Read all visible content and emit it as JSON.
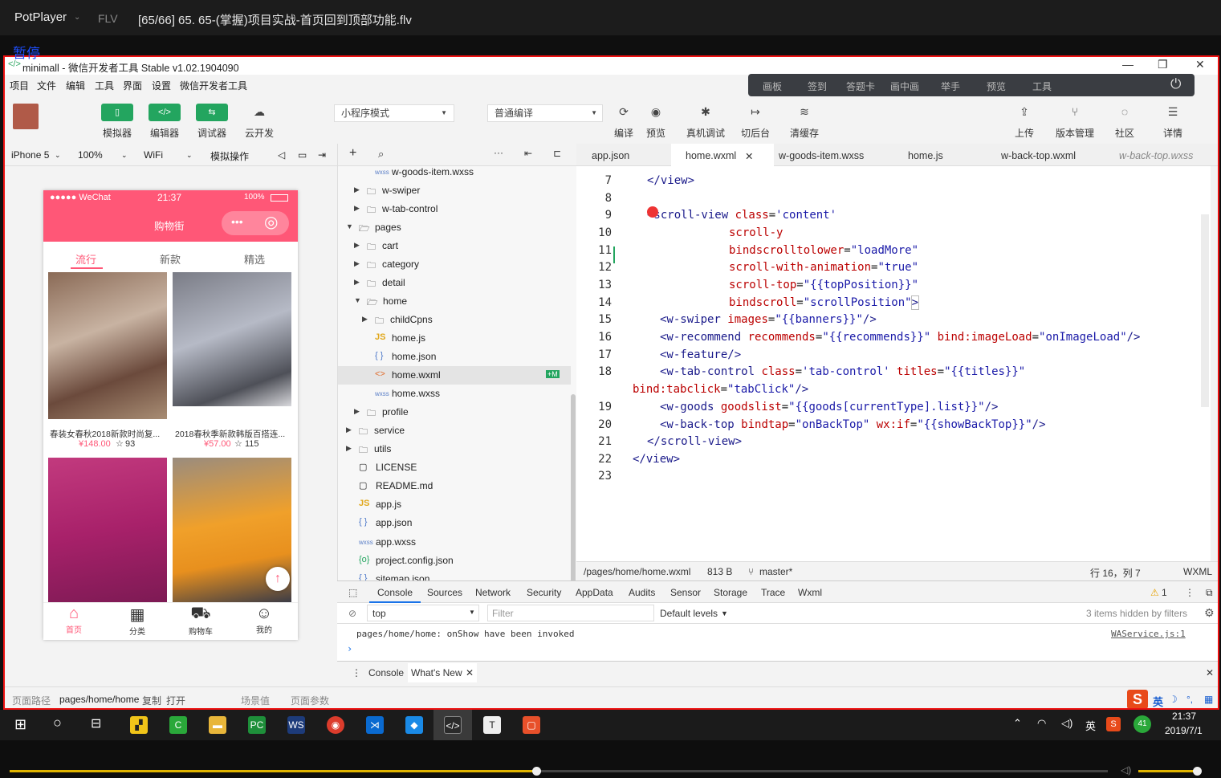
{
  "player": {
    "brand": "PotPlayer",
    "format": "FLV",
    "title": "[65/66] 65. 65-(掌握)项目实战-首页回到顶部功能.flv",
    "pause_text": "暂停"
  },
  "window": {
    "title": "minimall - 微信开发者工具 Stable v1.02.1904090"
  },
  "menu": [
    "项目",
    "文件",
    "编辑",
    "工具",
    "界面",
    "设置",
    "微信开发者工具"
  ],
  "overlay_menu": [
    "画板",
    "签到",
    "答题卡",
    "画中画",
    "举手",
    "预览",
    "工具"
  ],
  "toolbar": {
    "simulator": "模拟器",
    "editor": "编辑器",
    "debugger": "调试器",
    "cloud": "云开发",
    "mode": "小程序模式",
    "compile_mode": "普通编译",
    "compile": "编译",
    "preview": "预览",
    "remote_debug": "真机调试",
    "background": "切后台",
    "clear_cache": "清缓存",
    "upload": "上传",
    "version": "版本管理",
    "community": "社区",
    "details": "详情"
  },
  "device_bar": {
    "device": "iPhone 5",
    "zoom": "100%",
    "network": "WiFi",
    "operation": "模拟操作"
  },
  "phone": {
    "carrier": "●●●●● WeChat",
    "time": "21:37",
    "battery": "100%",
    "nav_title": "购物街",
    "tabs": [
      "流行",
      "新款",
      "精选"
    ],
    "goods": [
      {
        "name": "春装女春秋2018新款时尚复...",
        "price": "¥148.00",
        "fav": "93"
      },
      {
        "name": "2018春秋季新款韩版百搭连...",
        "price": "¥57.00",
        "fav": "115"
      }
    ],
    "tabbar": [
      "首页",
      "分类",
      "购物车",
      "我的"
    ]
  },
  "tree": {
    "rows": [
      "w-goods-item.wxss",
      "w-swiper",
      "w-tab-control",
      "pages",
      "cart",
      "category",
      "detail",
      "home",
      "childCpns",
      "home.js",
      "home.json",
      "home.wxml",
      "home.wxss",
      "profile",
      "service",
      "utils",
      "LICENSE",
      "README.md",
      "app.js",
      "app.json",
      "app.wxss",
      "project.config.json",
      "sitemap.json"
    ],
    "badge": "+M"
  },
  "editor_tabs": [
    "app.json",
    "home.wxml",
    "w-goods-item.wxss",
    "home.js",
    "w-back-top.wxml",
    "w-back-top.wxss"
  ],
  "code": {
    "line_numbers": [
      "7",
      "8",
      "9",
      "10",
      "11",
      "12",
      "13",
      "14",
      "15",
      "16",
      "17",
      "18",
      "",
      "19",
      "20",
      "21",
      "22",
      "23"
    ],
    "l7": "</view>",
    "l9a": "<scroll-view ",
    "l9b": "class",
    "l9c": "=",
    "l9d": "'content'",
    "l10": "scroll-y",
    "l11a": "bindscrolltolower",
    "l11b": "=",
    "l11c": "\"loadMore\"",
    "l12a": "scroll-with-animation",
    "l12b": "=",
    "l12c": "\"true\"",
    "l13a": "scroll-top",
    "l13b": "=",
    "l13c": "\"{{topPosition}}\"",
    "l14a": "bindscroll",
    "l14b": "=",
    "l14c": "\"scrollPosition\"",
    "l14d": ">",
    "l15a": "<w-swiper ",
    "l15b": "images",
    "l15c": "=",
    "l15d": "\"{{banners}}\"",
    "l15e": "/>",
    "l16a": "<w-recommend ",
    "l16b": "recommends",
    "l16c": "=",
    "l16d": "\"{{recommends}}\"",
    "l16e": " bind:imageLoad",
    "l16f": "=",
    "l16g": "\"onImageLoad\"",
    "l16h": "/>",
    "l17": "<w-feature/>",
    "l18a": "<w-tab-control ",
    "l18b": "class",
    "l18c": "=",
    "l18d": "'tab-control'",
    "l18e": " titles",
    "l18f": "=",
    "l18g": "\"{{titles}}\"",
    "l18w_a": "bind:tabclick",
    "l18w_b": "=",
    "l18w_c": "\"tabClick\"",
    "l18w_d": "/>",
    "l19a": "<w-goods ",
    "l19b": "goodslist",
    "l19c": "=",
    "l19d": "\"{{goods[currentType].list}}\"",
    "l19e": "/>",
    "l20a": "<w-back-top ",
    "l20b": "bindtap",
    "l20c": "=",
    "l20d": "\"onBackTop\"",
    "l20e": " wx:if",
    "l20f": "=",
    "l20g": "\"{{showBackTop}}\"",
    "l20h": "/>",
    "l21": "</scroll-view>",
    "l22": "</view>"
  },
  "editor_status": {
    "path": "/pages/home/home.wxml",
    "size": "813 B",
    "branch": "master*",
    "position": "行 16，列 7",
    "lang": "WXML"
  },
  "devtools": {
    "tabs": [
      "Console",
      "Sources",
      "Network",
      "Security",
      "AppData",
      "Audits",
      "Sensor",
      "Storage",
      "Trace",
      "Wxml"
    ],
    "warn": "1",
    "context": "top",
    "filter": "Filter",
    "levels": "Default levels",
    "hidden": "3 items hidden by filters",
    "log": "pages/home/home: onShow have been invoked",
    "log_src": "WAService.js:1",
    "drawer": [
      "Console",
      "What's New"
    ]
  },
  "page_status": {
    "path_label": "页面路径",
    "path": "pages/home/home",
    "copy": "复制",
    "open": "打开",
    "scene": "场景值",
    "params": "页面参数"
  },
  "taskbar": {
    "time": "21:37",
    "date": "2019/7/1",
    "lang": "英",
    "ime": "英",
    "badge": "41"
  },
  "colors": {
    "accent": "#ff5777",
    "green": "#23a55f",
    "border": "#e11111"
  }
}
